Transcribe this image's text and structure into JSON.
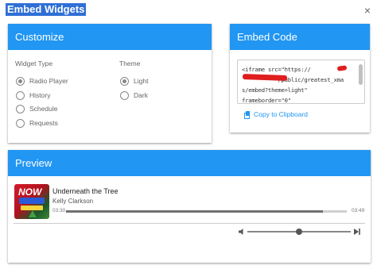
{
  "dialog": {
    "title": "Embed Widgets",
    "close_symbol": "×"
  },
  "customize": {
    "header": "Customize",
    "widget_type": {
      "label": "Widget Type",
      "options": [
        "Radio Player",
        "History",
        "Schedule",
        "Requests"
      ],
      "selected": "Radio Player"
    },
    "theme": {
      "label": "Theme",
      "options": [
        "Light",
        "Dark"
      ],
      "selected": "Light"
    }
  },
  "embed_code": {
    "header": "Embed Code",
    "code_lines": [
      "<iframe src=\"https://",
      "           /public/greatest_xma",
      "s/embed?theme=light\"",
      "frameborder=\"0\""
    ],
    "copy_label": "Copy to Clipboard"
  },
  "preview": {
    "header": "Preview",
    "player": {
      "song_title": "Underneath the Tree",
      "artist": "Kelly Clarkson",
      "time_current": "03:30",
      "time_total": "03:49",
      "progress": 0.916,
      "volume": 0.5,
      "album_art_text": "NOW"
    }
  },
  "colors": {
    "header_blue": "#2196f3",
    "title_highlight": "#2f6fd6",
    "link_blue": "#2196f3",
    "redaction_red": "#e01e1e"
  },
  "icons": {
    "close": "close-icon",
    "copy": "clipboard-icon",
    "volume": "volume-icon",
    "skip": "skip-next-icon"
  }
}
